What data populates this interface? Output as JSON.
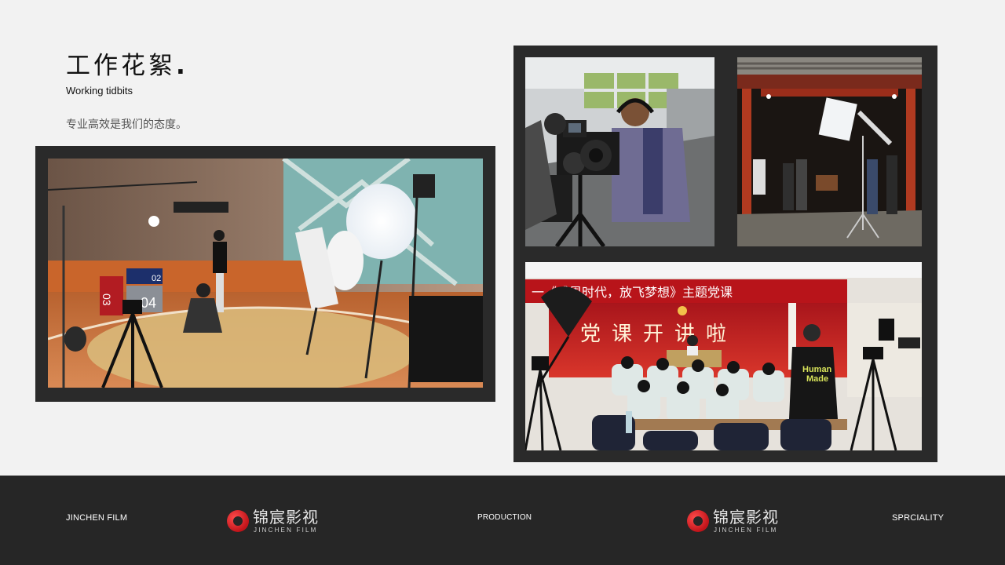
{
  "header": {
    "title": "工作花絮",
    "title_dot": ".",
    "subtitle": "Working tidbits",
    "tagline": "专业高效是我们的态度。"
  },
  "photos": {
    "studio": {
      "icon": "studio-photo"
    },
    "camera_crew": {
      "icon": "camera-crew-photo"
    },
    "heritage_set": {
      "icon": "heritage-set-photo"
    },
    "party_lesson": {
      "icon": "party-lesson-photo",
      "banner_text": "一《感恩时代，放飞梦想》主题党课",
      "backdrop_text": "党课开讲啦",
      "shirt_text_1": "Human",
      "shirt_text_2": "Made",
      "studio_numbers": [
        "02",
        "04",
        "03"
      ]
    }
  },
  "footer": {
    "left_text": "JINCHEN FILM",
    "middle_text": "PRODUCTION",
    "right_text": "SPRCIALITY",
    "logo_cn": "锦宸影视",
    "logo_en": "JINCHEN FILM"
  },
  "colors": {
    "background": "#f2f2f2",
    "frame": "#2a2a2a",
    "footer": "#262626",
    "logo_red": "#d11a1f"
  }
}
